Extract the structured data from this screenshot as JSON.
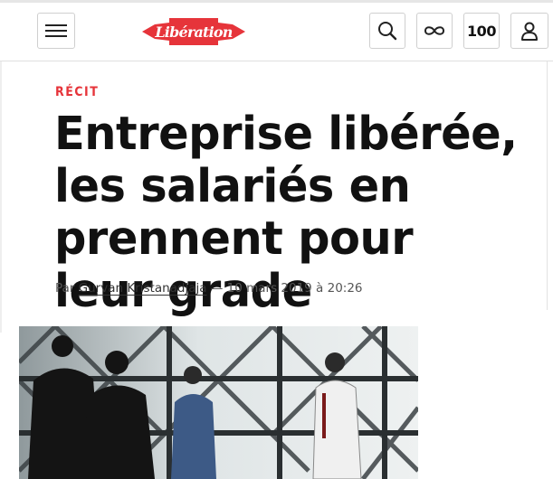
{
  "header": {
    "logo_text": "Libération",
    "hundred_label": "100",
    "icons": [
      "menu-icon",
      "search-icon",
      "infinity-icon",
      "user-icon"
    ]
  },
  "article": {
    "kicker": "RÉCIT",
    "title": "Entreprise libérée, les salariés en prennent pour leur grade",
    "byline_prefix": "Par",
    "author": "Gurvan Kristanadjaja",
    "separator": " — ",
    "date": "10 mars 2019 à 20:26"
  },
  "colors": {
    "brand_red": "#e6343a",
    "text": "#111111"
  }
}
